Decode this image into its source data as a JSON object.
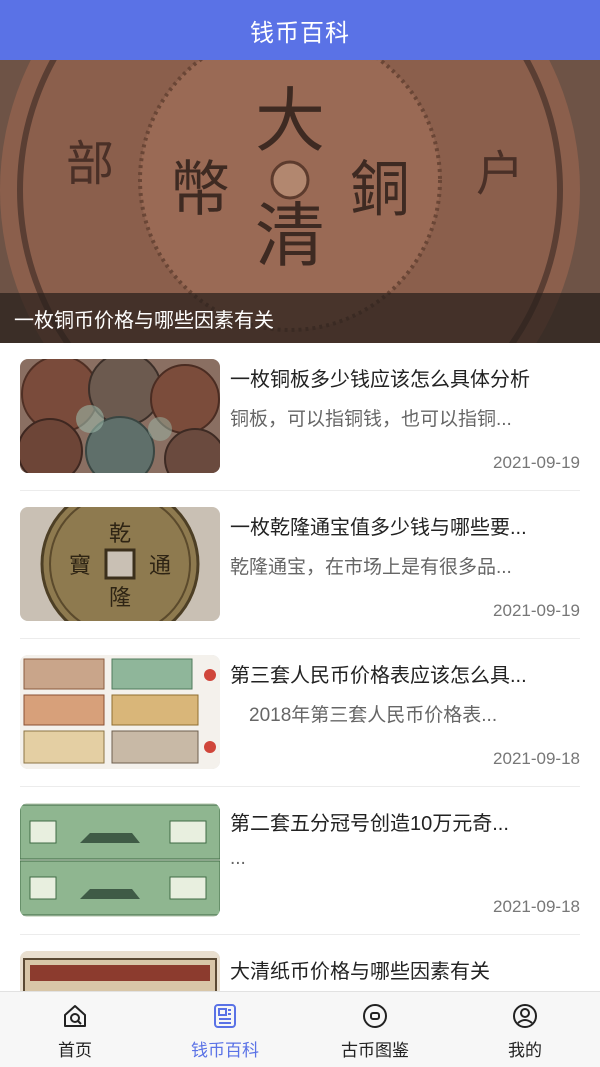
{
  "header": {
    "title": "钱币百科"
  },
  "banner": {
    "caption": "一枚铜币价格与哪些因素有关"
  },
  "articles": [
    {
      "title": "一枚铜板多少钱应该怎么具体分析",
      "summary": "铜板，可以指铜钱，也可以指铜...",
      "date": "2021-09-19",
      "thumb_icon": "copper-coins-image"
    },
    {
      "title": "一枚乾隆通宝值多少钱与哪些要...",
      "summary": "乾隆通宝，在市场上是有很多品...",
      "date": "2021-09-19",
      "thumb_icon": "qianlong-coin-image"
    },
    {
      "title": "第三套人民币价格表应该怎么具...",
      "summary": "　2018年第三套人民币价格表...",
      "date": "2021-09-18",
      "thumb_icon": "banknotes-image"
    },
    {
      "title": "第二套五分冠号创造10万元奇...",
      "summary": "...",
      "date": "2021-09-18",
      "thumb_icon": "green-banknotes-image"
    },
    {
      "title": "大清纸币价格与哪些因素有关",
      "summary": "",
      "date": "",
      "thumb_icon": "qing-banknote-image"
    }
  ],
  "tabbar": {
    "tabs": [
      {
        "label": "首页",
        "icon": "home-icon",
        "active": false
      },
      {
        "label": "钱币百科",
        "icon": "encyclopedia-icon",
        "active": true
      },
      {
        "label": "古币图鉴",
        "icon": "coin-catalog-icon",
        "active": false
      },
      {
        "label": "我的",
        "icon": "profile-icon",
        "active": false
      }
    ]
  },
  "colors": {
    "accent": "#5a72e6",
    "text": "#222222",
    "muted": "#666666"
  }
}
